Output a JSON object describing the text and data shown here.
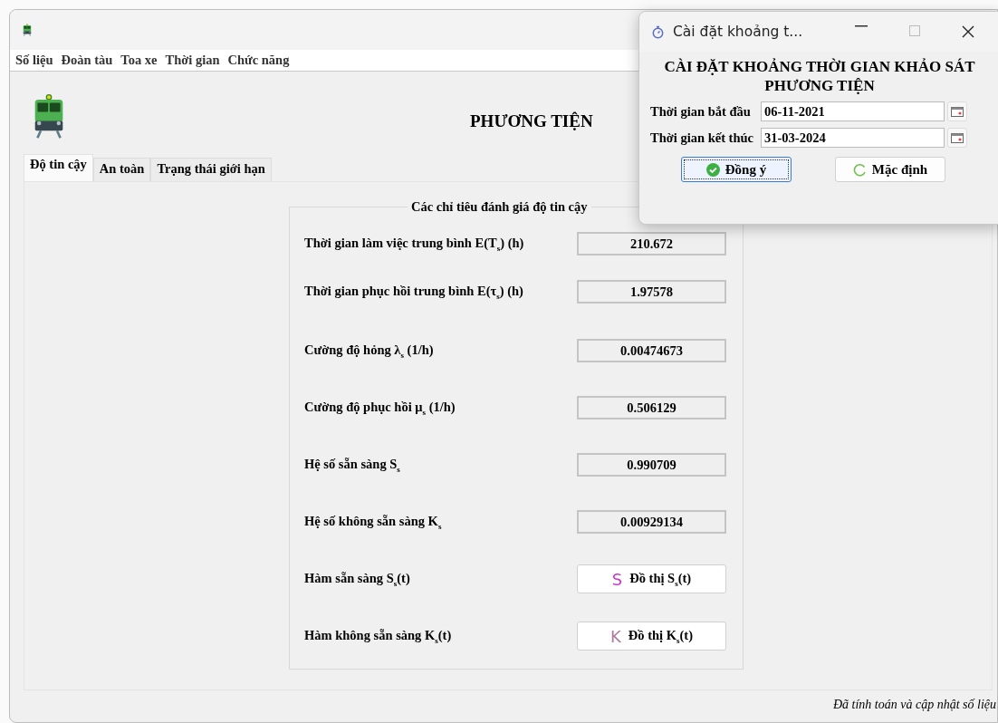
{
  "main_window": {
    "menu": [
      "Số liệu",
      "Đoàn tàu",
      "Toa xe",
      "Thời gian",
      "Chức năng"
    ],
    "heading": "PHƯƠNG TIỆN",
    "tabs": [
      {
        "label": "Độ tin cậy",
        "selected": true
      },
      {
        "label": "An toàn",
        "selected": false
      },
      {
        "label": "Trạng thái giới hạn",
        "selected": false
      }
    ],
    "group_title": "Các chỉ tiêu đánh giá độ tin cậy",
    "rows": [
      {
        "kind": "value",
        "label": "Thời gian làm việc trung bình E(T$_{s}$) (h)",
        "value": "210.672"
      },
      {
        "kind": "value",
        "label": "Thời gian phục hồi trung bình E(τ$_{s}$) (h)",
        "value": "1.97578"
      },
      {
        "kind": "value",
        "label": "Cường độ hỏng λ$_{s}$ (1/h)",
        "value": "0.00474673"
      },
      {
        "kind": "value",
        "label": "Cường độ phục hồi μ$_{s}$ (1/h)",
        "value": "0.506129"
      },
      {
        "kind": "value",
        "label": "Hệ số sẵn sàng S$_{s}$",
        "value": "0.990709"
      },
      {
        "kind": "value",
        "label": "Hệ số không sẵn sàng K$_{s}$",
        "value": "0.00929134"
      },
      {
        "kind": "button",
        "label": "Hàm sẵn sàng S$_{s}$(t)",
        "icon_letter": "S",
        "color": "#c83cc8",
        "button": "Đồ thị S$_{s}$(t)"
      },
      {
        "kind": "button",
        "label": "Hàm không sẵn sàng K$_{s}$(t)",
        "icon_letter": "K",
        "color": "#b07aa0",
        "button": "Đồ thị K$_{s}$(t)"
      }
    ],
    "status_bar": "Đã tính toán và cập nhật số liệu"
  },
  "dialog": {
    "title": "Cài đặt khoảng t...",
    "heading": "CÀI ĐẶT KHOẢNG THỜI GIAN KHẢO SÁT PHƯƠNG TIỆN",
    "fields": [
      {
        "label": "Thời gian bắt đầu",
        "value": "06-11-2021"
      },
      {
        "label": "Thời gian kết thúc",
        "value": "31-03-2024"
      }
    ],
    "buttons": [
      {
        "kind": "ok",
        "label": "Đồng ý",
        "focused": true
      },
      {
        "kind": "reset",
        "label": "Mặc định",
        "focused": false
      }
    ]
  }
}
